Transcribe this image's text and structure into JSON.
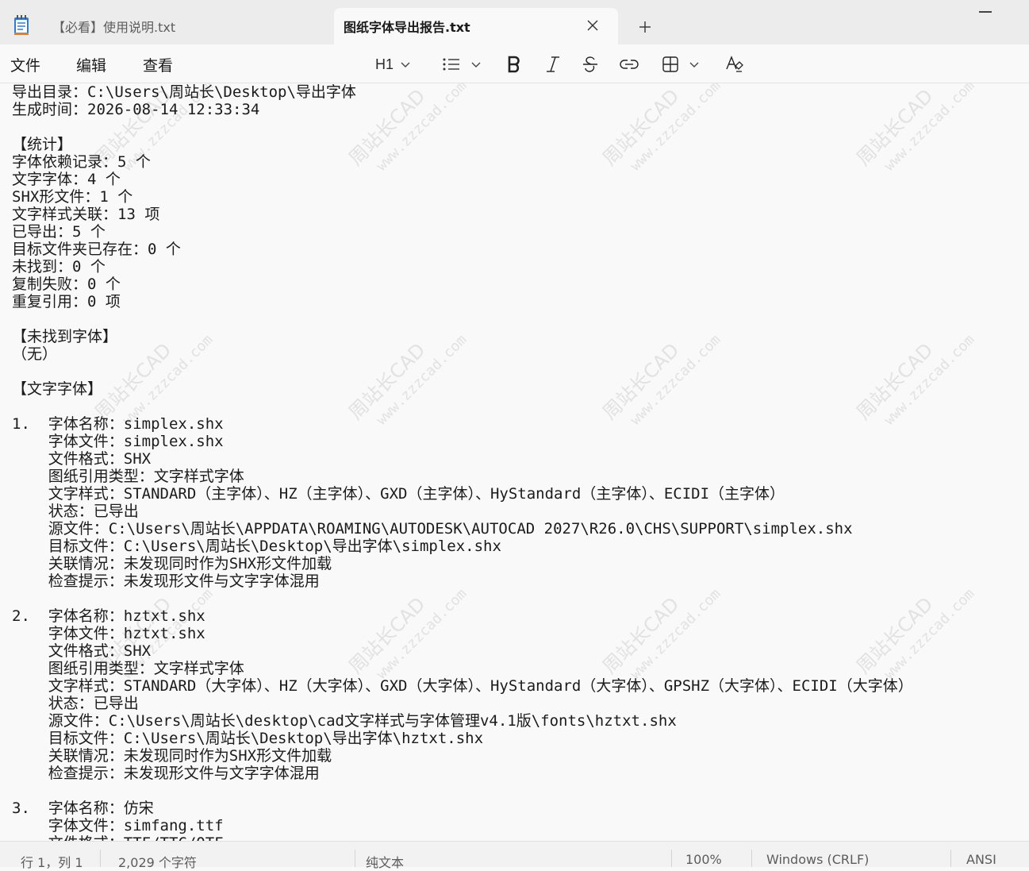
{
  "tabs": [
    {
      "label": "【必看】使用说明.txt",
      "active": false
    },
    {
      "label": "图纸字体导出报告.txt",
      "active": true
    }
  ],
  "menu": {
    "file": "文件",
    "edit": "编辑",
    "view": "查看"
  },
  "format_toolbar": {
    "heading": "H1"
  },
  "watermark": {
    "brand": "周站长CAD",
    "site": "www.zzzcad.com"
  },
  "document": {
    "lines": [
      "导出目录：C:\\Users\\周站长\\Desktop\\导出字体",
      "生成时间：2026-08-14 12:33:34",
      "",
      "【统计】",
      "字体依赖记录：5 个",
      "文字字体：4 个",
      "SHX形文件：1 个",
      "文字样式关联：13 项",
      "已导出：5 个",
      "目标文件夹已存在：0 个",
      "未找到：0 个",
      "复制失败：0 个",
      "重复引用：0 项",
      "",
      "【未找到字体】",
      "（无）",
      "",
      "【文字字体】",
      "",
      "1.  字体名称：simplex.shx",
      "    字体文件：simplex.shx",
      "    文件格式：SHX",
      "    图纸引用类型：文字样式字体",
      "    文字样式：STANDARD（主字体）、HZ（主字体）、GXD（主字体）、HyStandard（主字体）、ECIDI（主字体）",
      "    状态：已导出",
      "    源文件：C:\\Users\\周站长\\APPDATA\\ROAMING\\AUTODESK\\AUTOCAD 2027\\R26.0\\CHS\\SUPPORT\\simplex.shx",
      "    目标文件：C:\\Users\\周站长\\Desktop\\导出字体\\simplex.shx",
      "    关联情况：未发现同时作为SHX形文件加载",
      "    检查提示：未发现形文件与文字字体混用",
      "",
      "2.  字体名称：hztxt.shx",
      "    字体文件：hztxt.shx",
      "    文件格式：SHX",
      "    图纸引用类型：文字样式字体",
      "    文字样式：STANDARD（大字体）、HZ（大字体）、GXD（大字体）、HyStandard（大字体）、GPSHZ（大字体）、ECIDI（大字体）",
      "    状态：已导出",
      "    源文件：C:\\Users\\周站长\\desktop\\cad文字样式与字体管理v4.1版\\fonts\\hztxt.shx",
      "    目标文件：C:\\Users\\周站长\\Desktop\\导出字体\\hztxt.shx",
      "    关联情况：未发现同时作为SHX形文件加载",
      "    检查提示：未发现形文件与文字字体混用",
      "",
      "3.  字体名称：仿宋",
      "    字体文件：simfang.ttf",
      "    文件格式：TTF/TTC/OTF"
    ]
  },
  "status": {
    "position": "行 1，列 1",
    "char_count": "2,029 个字符",
    "format": "纯文本",
    "zoom": "100%",
    "line_ending": "Windows (CRLF)",
    "encoding": "ANSI"
  }
}
